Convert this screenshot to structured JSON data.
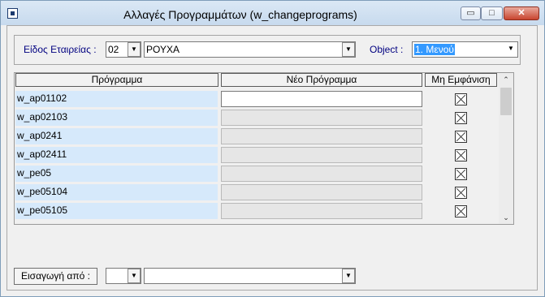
{
  "window": {
    "title": "Αλλαγές Προγραμμάτων   (w_changeprograms)",
    "controls": {
      "minimize": "▭",
      "maximize": "□",
      "close": "✕"
    }
  },
  "filters": {
    "company_type_label": "Είδος Εταιρείας :",
    "company_type_code": "02",
    "company_type_name": "ΡΟΥΧΑ",
    "object_label": "Object  :",
    "object_value": "1. Μενού"
  },
  "grid": {
    "columns": [
      "Πρόγραμμα",
      "Νέο Πρόγραμμα",
      "Μη Εμφάνιση"
    ],
    "rows": [
      {
        "program": "w_ap01102",
        "new_program": "",
        "hidden": true
      },
      {
        "program": "w_ap02103",
        "new_program": "",
        "hidden": true
      },
      {
        "program": "w_ap0241",
        "new_program": "",
        "hidden": true
      },
      {
        "program": "w_ap02411",
        "new_program": "",
        "hidden": true
      },
      {
        "program": "w_pe05",
        "new_program": "",
        "hidden": true
      },
      {
        "program": "w_pe05104",
        "new_program": "",
        "hidden": true
      },
      {
        "program": "w_pe05105",
        "new_program": "",
        "hidden": true
      }
    ]
  },
  "import": {
    "button_label": "Εισαγωγή από :",
    "code": "",
    "name": ""
  },
  "icons": {
    "dropdown": "▼",
    "scroll_up": "⌃",
    "scroll_down": "⌄"
  }
}
